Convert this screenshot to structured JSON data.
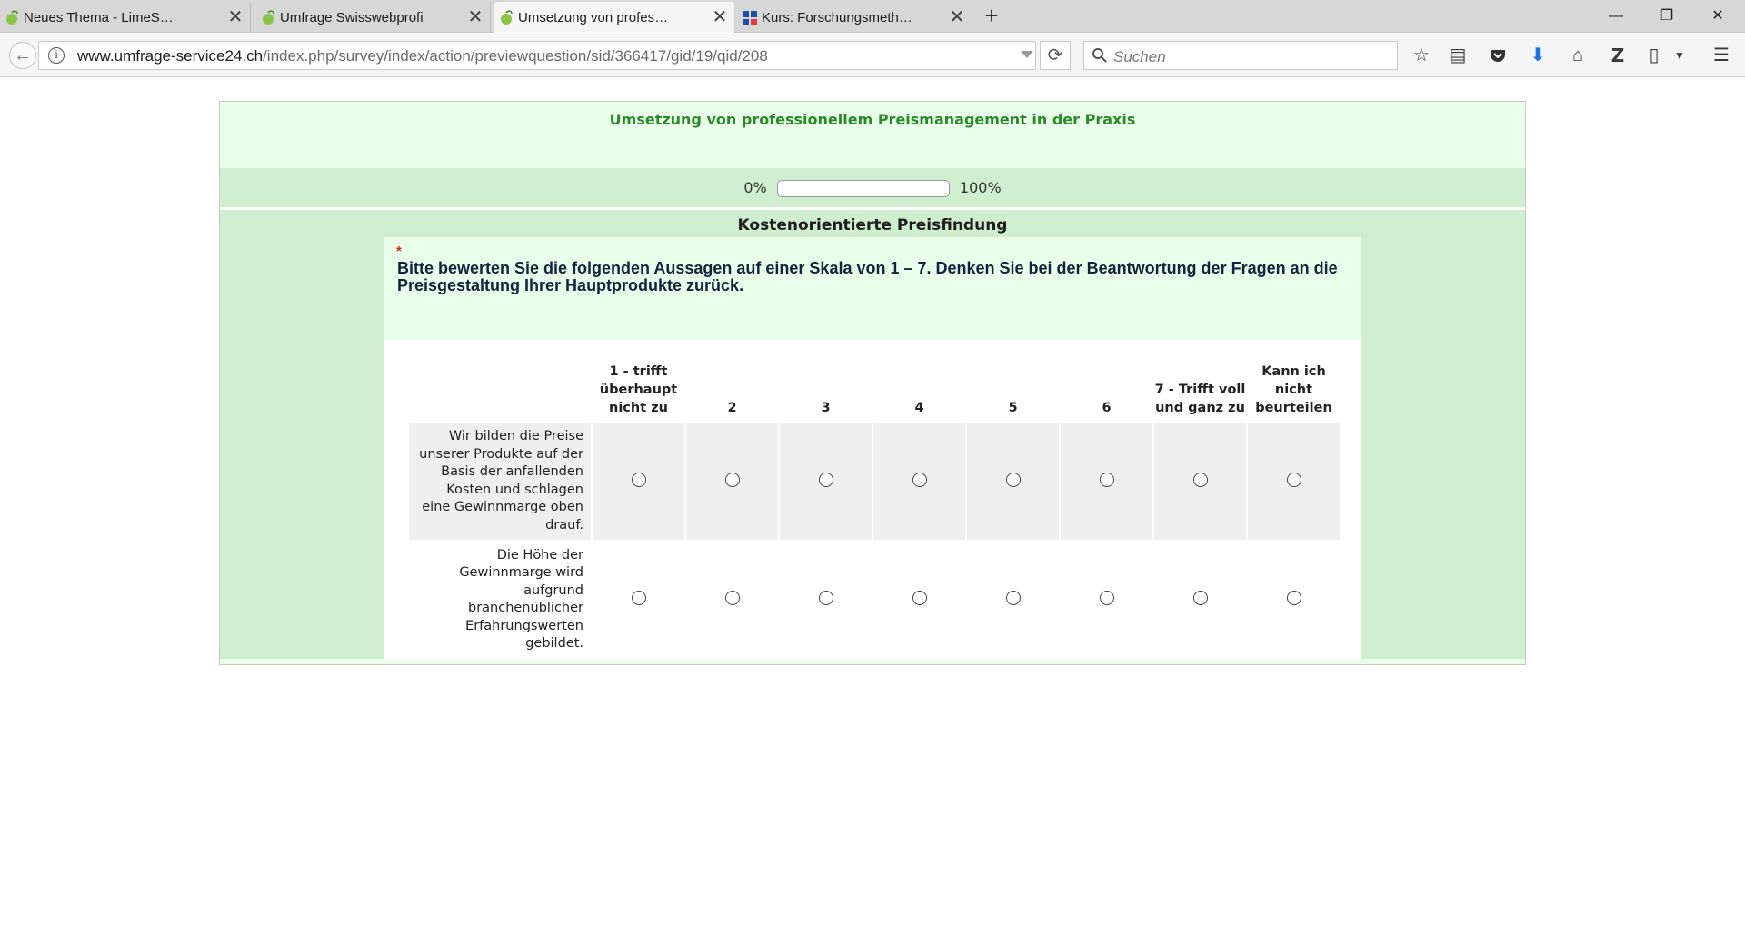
{
  "browser": {
    "tabs": [
      {
        "label": "Neues Thema - LimeSurve...",
        "active": false,
        "icon": "limesurvey-icon"
      },
      {
        "label": "Umfrage Swisswebprofi",
        "active": false,
        "icon": "limesurvey-icon"
      },
      {
        "label": "Umsetzung von professio...",
        "active": true,
        "icon": "limesurvey-icon"
      },
      {
        "label": "Kurs: Forschungsmethodik...",
        "active": false,
        "icon": "moodle-icon"
      }
    ],
    "close_glyph": "✕",
    "new_tab_glyph": "+",
    "window": {
      "minimize": "—",
      "restore": "❐",
      "close": "✕"
    },
    "url": {
      "domain": "www.umfrage-service24.ch",
      "path": "/index.php/survey/index/action/previewquestion/sid/366417/gid/19/qid/208"
    },
    "search_placeholder": "Suchen",
    "nav_glyphs": {
      "back": "←",
      "reload": "⟳",
      "info": "i"
    }
  },
  "survey": {
    "title": "Umsetzung von professionellem Preismanagement in der Praxis",
    "progress": {
      "min_label": "0%",
      "max_label": "100%",
      "value_percent": 0
    },
    "group_title": "Kostenorientierte Preisfindung",
    "question": {
      "required_marker": "*",
      "text": "Bitte bewerten Sie die folgenden Aussagen auf einer Skala von 1 – 7. Denken Sie bei der Beantwortung der Fragen an die Preisgestaltung Ihrer Hauptprodukte zurück."
    },
    "columns": [
      "1 - trifft überhaupt nicht zu",
      "2",
      "3",
      "4",
      "5",
      "6",
      "7 - Trifft voll und ganz zu",
      "Kann ich nicht beurteilen"
    ],
    "rows": [
      {
        "label": "Wir bilden die Preise unserer Produkte auf der Basis der anfallenden Kosten und schlagen eine Gewinnmarge oben drauf."
      },
      {
        "label": "Die Höhe der Gewinnmarge wird aufgrund branchenüblicher Erfahrungswerten gebildet."
      }
    ]
  }
}
